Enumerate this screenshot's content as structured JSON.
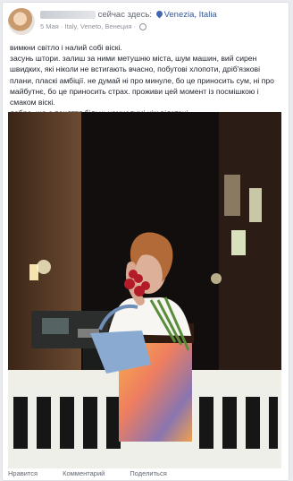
{
  "post": {
    "author": "",
    "status": "сейчас здесь:",
    "location": "Venezia, Italia",
    "date": "5 Мая",
    "place": "Italy, Veneto, Венеция",
    "lines": [
      "вимкни світло і налий собі віскі.",
      "засунь штори. залиш за ними метушню міста, шум машин, вий сирен швидких, які ніколи не встигають вчасно, побутові хлопоти, дріб'язкові плани, пласкі амбіції. не думай ні про минуле, бо це приносить сум, ні про майбутнє, бо це приносить страх. проживи цей момент із посмішкою і смаком віскі.",
      "добре, що є поняття більш немислимі ніж відстані..."
    ]
  },
  "actions": {
    "like": "Нравится",
    "comment": "Комментарий",
    "share": "Поделиться"
  },
  "colors": {
    "brand_link": "#385898",
    "text": "#1d2129",
    "muted": "#90949c"
  }
}
